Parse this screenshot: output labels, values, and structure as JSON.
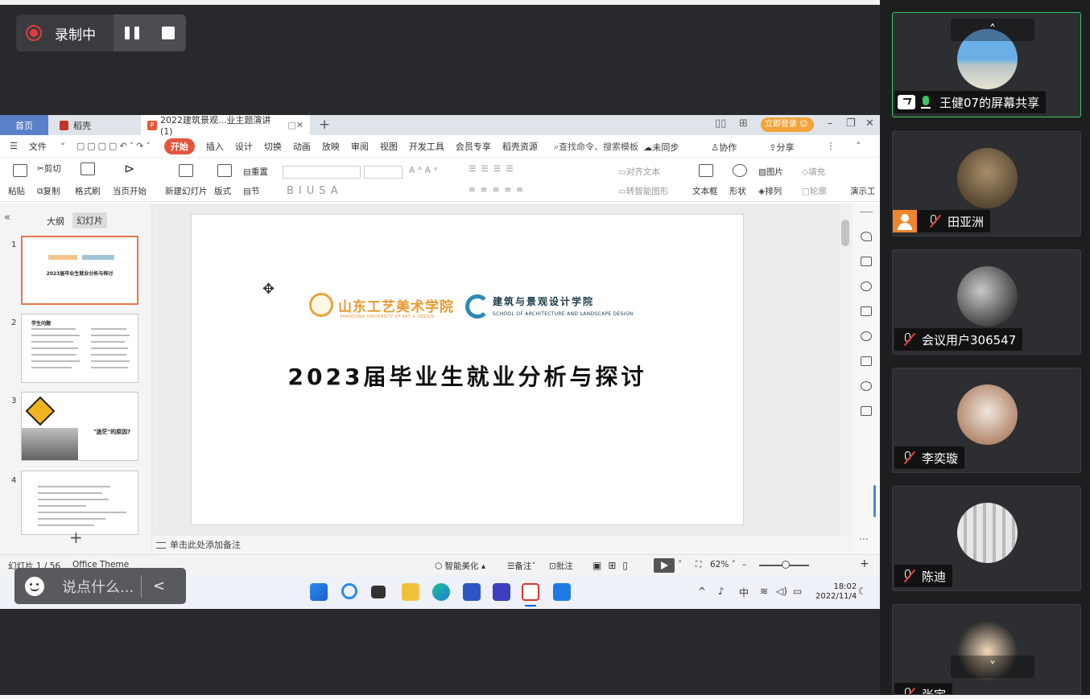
{
  "recording": {
    "status_label": "录制中"
  },
  "wps": {
    "tabs": [
      {
        "label": "首页"
      },
      {
        "label": "稻壳"
      },
      {
        "label": "2022建筑景观...业主题演讲(1)"
      }
    ],
    "login_label": "立即登录",
    "menu": [
      "文件",
      "开始",
      "插入",
      "设计",
      "切换",
      "动画",
      "放映",
      "审阅",
      "视图",
      "开发工具",
      "会员专享",
      "稻壳资源"
    ],
    "search_placeholder": "查找命令、搜索模板",
    "menu_right": [
      "未同步",
      "协作",
      "分享"
    ],
    "ribbon": {
      "cut": "剪切",
      "paste": "粘贴",
      "copy": "复制",
      "format_painter": "格式刷",
      "from_current": "当页开始",
      "new_slide": "新建幻灯片",
      "layout": "版式",
      "section": "节",
      "reset": "重置",
      "align_text": "对齐文本",
      "smart_shape": "转智能图形",
      "textbox": "文本框",
      "shape": "形状",
      "picture": "图片",
      "arrange": "排列",
      "fill": "填充",
      "outline": "轮廓",
      "present": "演示工"
    },
    "panel_tabs": [
      "大纲",
      "幻灯片"
    ],
    "thumbnails": [
      {
        "num": "1",
        "title": "2023届毕业生就业分析与探讨"
      },
      {
        "num": "2",
        "title": "学生问题"
      },
      {
        "num": "3",
        "title": "\"迷茫\"的原因?"
      },
      {
        "num": "4",
        "title": ""
      }
    ],
    "slide": {
      "logo1_text": "山东工艺美术学院",
      "logo1_sub": "SHANDONG UNIVERSITY OF ART & DESIGN",
      "logo2_text": "建筑与景观设计学院",
      "logo2_sub": "SCHOOL OF ARCHITECTURE AND LANDSCAPE DESIGN",
      "title": "2023届毕业生就业分析与探讨"
    },
    "notes_placeholder": "单击此处添加备注",
    "status": {
      "slide_count": "幻灯片 1 / 56",
      "theme": "Office Theme",
      "smart_beautify": "智能美化",
      "notes": "备注",
      "comments": "批注",
      "zoom": "62%"
    },
    "clock": {
      "time": "18:02",
      "date": "2022/11/4"
    },
    "tray_ime": "中"
  },
  "chat": {
    "placeholder": "说点什么..."
  },
  "participants": [
    {
      "name": "王健07的屏幕共享",
      "mic": "on",
      "sharing": true,
      "active": true
    },
    {
      "name": "田亚洲",
      "mic": "off",
      "badge": "person"
    },
    {
      "name": "会议用户306547",
      "mic": "off"
    },
    {
      "name": "李奕璇",
      "mic": "off"
    },
    {
      "name": "陈迪",
      "mic": "off"
    },
    {
      "name": "张宇",
      "mic": "off"
    }
  ],
  "colors": {
    "accent_green": "#3fc466",
    "wps_orange": "#e5553c",
    "record_red": "#e03c3c"
  }
}
